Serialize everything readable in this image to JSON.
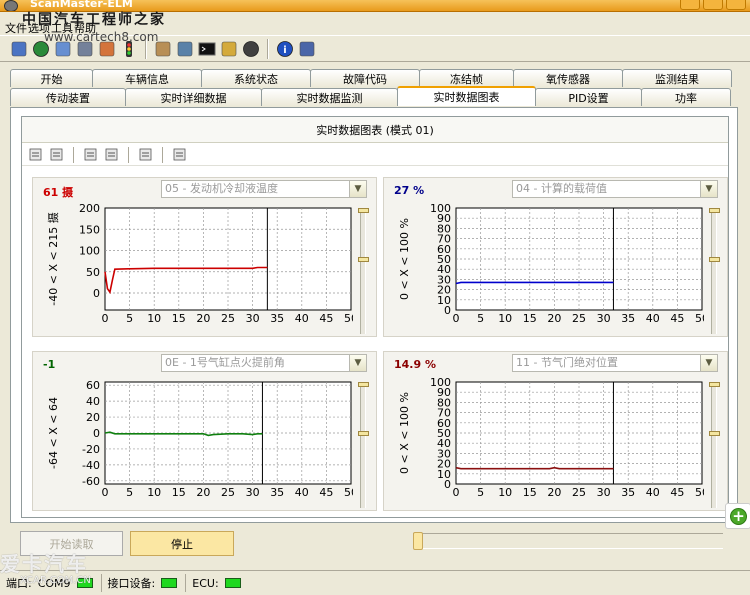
{
  "window": {
    "title": "ScanMaster-ELM"
  },
  "watermark": {
    "line1": "中国汽车工程师之家",
    "line2": "www.cartech8.com",
    "brand": "爱卡汽车",
    "brand2": "XCAR.COM.CN"
  },
  "menu": [
    "文件",
    "选项",
    "工具",
    "帮助"
  ],
  "toolbar_icons": [
    "connect-icon",
    "globe-icon",
    "document-icon",
    "chart-icon",
    "palette-icon",
    "traffic-light-icon",
    "clipboard-icon",
    "monitor-search-icon",
    "terminal-icon",
    "battery-icon",
    "gauge-icon",
    "info-icon",
    "exit-icon"
  ],
  "tabs_row1": [
    "开始",
    "车辆信息",
    "系统状态",
    "故障代码",
    "冻结帧",
    "氧传感器",
    "监测结果"
  ],
  "tabs_row2": [
    "传动装置",
    "实时详细数据",
    "实时数据监测",
    "实时数据图表",
    "PID设置",
    "功率"
  ],
  "active_tab": "实时数据图表",
  "panel": {
    "title": "实时数据图表 (模式 01)"
  },
  "chart_toolbar_icons": [
    "add-chart-icon",
    "remove-chart-icon",
    "open-icon",
    "save-icon",
    "print-icon",
    "export-icon"
  ],
  "chart_data": [
    {
      "type": "line",
      "current_value": "61 摄",
      "value_color": "#cc0000",
      "pid_label": "05 - 发动机冷却液温度",
      "ylabel": "-40 < X < 215 摄",
      "xlim": [
        0,
        50
      ],
      "ylim": [
        -40,
        200
      ],
      "xticks": [
        0,
        5,
        10,
        15,
        20,
        25,
        30,
        35,
        40,
        45,
        50
      ],
      "yticks": [
        -40,
        0,
        50,
        100,
        150,
        200
      ],
      "ytick_labels": [
        "",
        "0",
        "50",
        "100",
        "150",
        "200"
      ],
      "cursor_x": 33,
      "line_color": "#cc0000",
      "series": [
        {
          "x": [
            0,
            0.5,
            1,
            1.5,
            2,
            5,
            10,
            15,
            20,
            25,
            30,
            31,
            33
          ],
          "y": [
            50,
            10,
            2,
            30,
            56,
            57,
            58,
            58,
            58,
            58,
            58,
            60,
            60
          ]
        }
      ]
    },
    {
      "type": "line",
      "current_value": "27 %",
      "value_color": "#00008b",
      "pid_label": "04 - 计算的载荷值",
      "ylabel": "0 < X < 100 %",
      "xlim": [
        0,
        50
      ],
      "ylim": [
        0,
        100
      ],
      "xticks": [
        0,
        5,
        10,
        15,
        20,
        25,
        30,
        35,
        40,
        45,
        50
      ],
      "yticks": [
        0,
        10,
        20,
        30,
        40,
        50,
        60,
        70,
        80,
        90,
        100
      ],
      "ytick_labels": [
        "0",
        "10",
        "20",
        "30",
        "40",
        "50",
        "60",
        "70",
        "80",
        "90",
        "100"
      ],
      "cursor_x": 32,
      "line_color": "#0000cc",
      "series": [
        {
          "x": [
            0,
            1,
            5,
            10,
            15,
            20,
            25,
            30,
            32
          ],
          "y": [
            26,
            27,
            27,
            27,
            27,
            27,
            27,
            27,
            27
          ]
        }
      ]
    },
    {
      "type": "line",
      "current_value": "-1",
      "value_color": "#006400",
      "pid_label": "0E - 1号气缸点火提前角",
      "ylabel": "-64 < X < 64",
      "xlim": [
        0,
        50
      ],
      "ylim": [
        -64,
        64
      ],
      "xticks": [
        0,
        5,
        10,
        15,
        20,
        25,
        30,
        35,
        40,
        45,
        50
      ],
      "yticks": [
        -60,
        -40,
        -20,
        0,
        20,
        40,
        60
      ],
      "ytick_labels": [
        "-60",
        "-40",
        "-20",
        "0",
        "20",
        "40",
        "60"
      ],
      "cursor_x": 32,
      "line_color": "#108010",
      "series": [
        {
          "x": [
            0,
            1,
            2,
            5,
            10,
            15,
            20,
            21,
            22,
            25,
            28,
            30,
            31,
            32
          ],
          "y": [
            0,
            1,
            -1,
            -1,
            -1,
            -1,
            -1,
            -3,
            -2,
            -1,
            -1,
            -2,
            -1,
            -1
          ]
        }
      ]
    },
    {
      "type": "line",
      "current_value": "14.9 %",
      "value_color": "#8b0000",
      "pid_label": "11 - 节气门绝对位置",
      "ylabel": "0 < X < 100 %",
      "xlim": [
        0,
        50
      ],
      "ylim": [
        0,
        100
      ],
      "xticks": [
        0,
        5,
        10,
        15,
        20,
        25,
        30,
        35,
        40,
        45,
        50
      ],
      "yticks": [
        0,
        10,
        20,
        30,
        40,
        50,
        60,
        70,
        80,
        90,
        100
      ],
      "ytick_labels": [
        "0",
        "10",
        "20",
        "30",
        "40",
        "50",
        "60",
        "70",
        "80",
        "90",
        "100"
      ],
      "cursor_x": 32,
      "line_color": "#8b1010",
      "series": [
        {
          "x": [
            0,
            1,
            5,
            10,
            15,
            19,
            20,
            21,
            25,
            30,
            32
          ],
          "y": [
            16,
            15,
            15,
            15,
            15,
            15,
            16,
            15,
            15,
            15,
            15
          ]
        }
      ]
    }
  ],
  "controls": {
    "start_label": "开始读取",
    "stop_label": "停止"
  },
  "status": {
    "port_label": "端口:",
    "port_value": "COM9",
    "iface_label": "接口设备:",
    "ecu_label": "ECU:"
  }
}
